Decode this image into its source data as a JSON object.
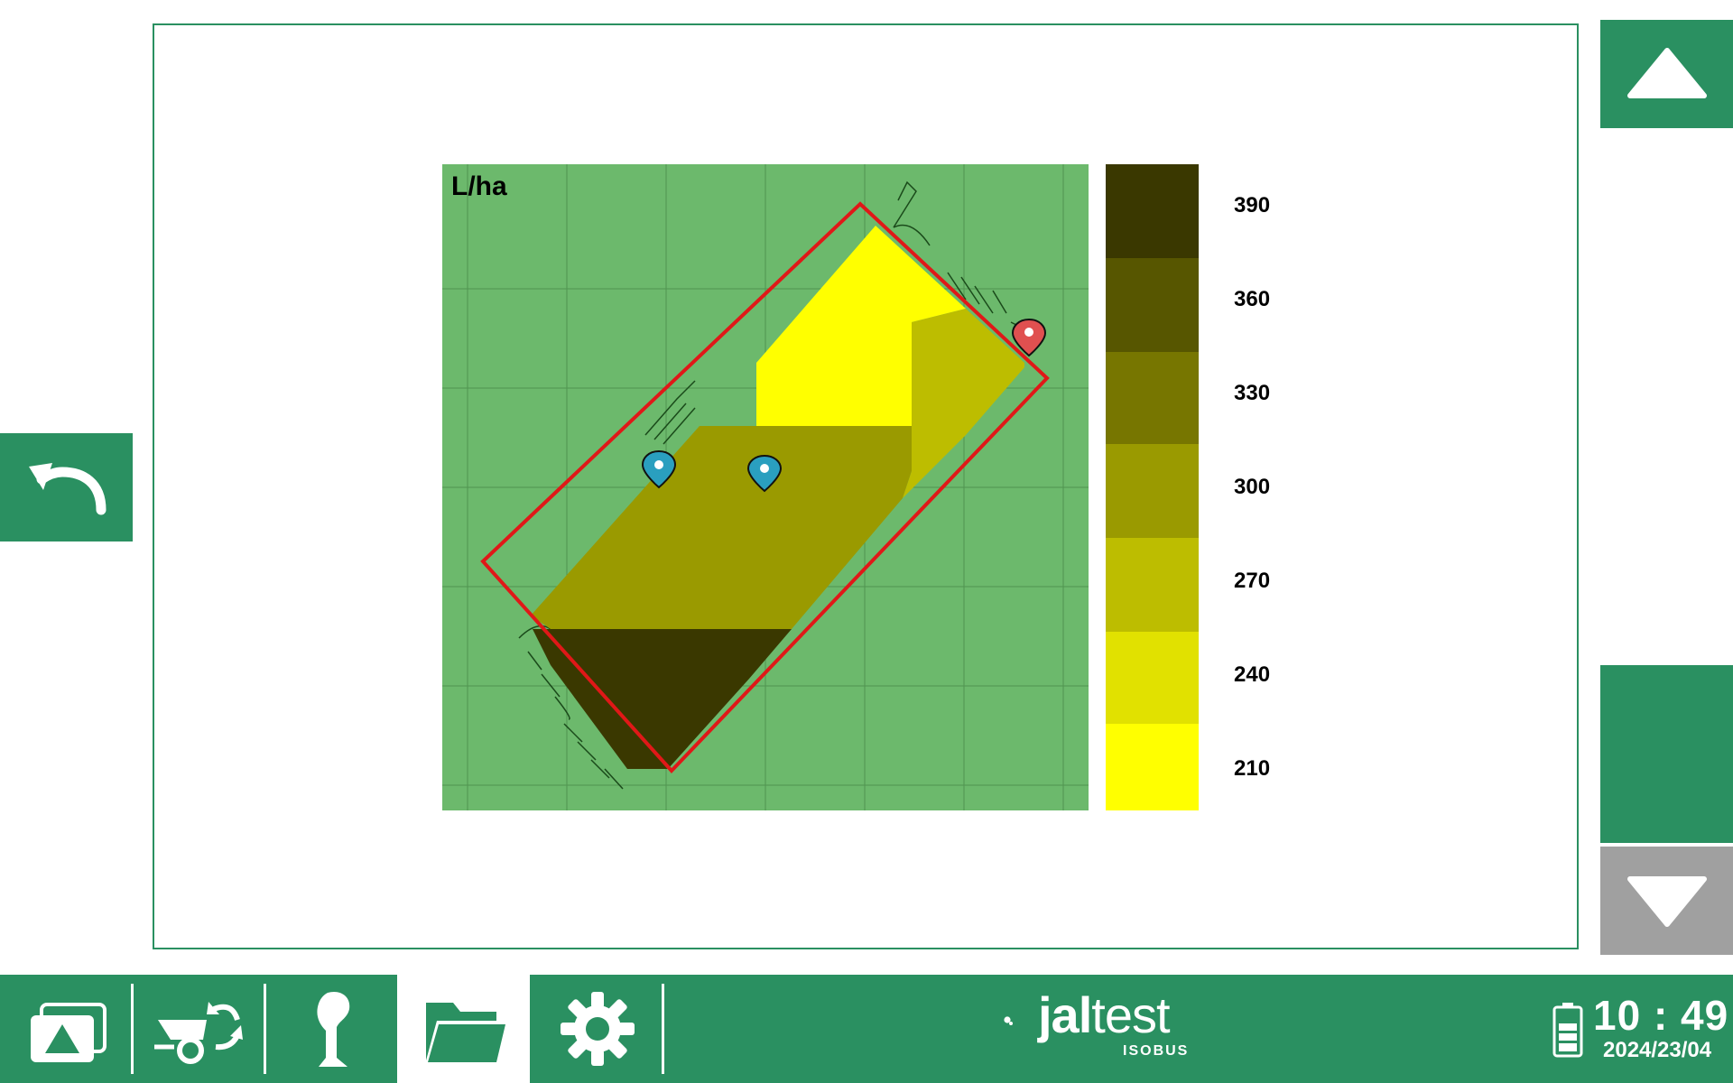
{
  "map": {
    "unit": "L/ha",
    "colors": {
      "background": "#6cb96c",
      "grid": "#4a8c4a",
      "boundary": "#e01818",
      "marker_blue": "#2a9fbf",
      "marker_red": "#e05050"
    },
    "legend": [
      {
        "label": "390",
        "color": "#3a3800"
      },
      {
        "label": "360",
        "color": "#575600"
      },
      {
        "label": "330",
        "color": "#777600"
      },
      {
        "label": "300",
        "color": "#9a9a00"
      },
      {
        "label": "270",
        "color": "#bdbd00"
      },
      {
        "label": "240",
        "color": "#e1e100"
      },
      {
        "label": "210",
        "color": "#ffff00"
      }
    ]
  },
  "nav": {
    "back_icon": "undo-arrow-icon",
    "up_icon": "triangle-up-icon",
    "down_icon": "triangle-down-icon"
  },
  "taskbar": {
    "items": [
      {
        "name": "home-screen-icon"
      },
      {
        "name": "implement-sync-icon"
      },
      {
        "name": "joystick-icon"
      },
      {
        "name": "folder-icon",
        "active": true
      },
      {
        "name": "gear-icon"
      }
    ],
    "brand": {
      "name_light": "jal",
      "name_rest": "test",
      "sub": "ISOBUS"
    },
    "time": "10 : 49",
    "date": "2024/23/04",
    "battery_icon": "battery-icon"
  },
  "theme": {
    "accent": "#2a9061",
    "disabled": "#a0a0a0"
  }
}
